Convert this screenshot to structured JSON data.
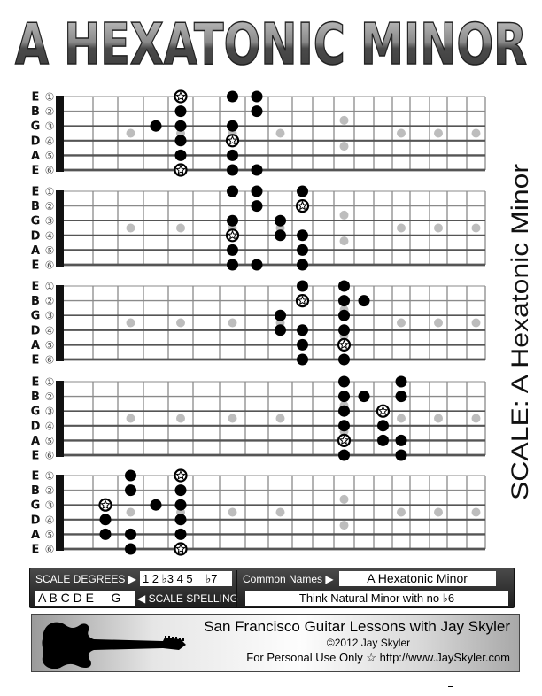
{
  "title": "A HEXATONIC MINOR",
  "side_title": "SCALE: A Hexatonic Minor",
  "strings": [
    {
      "name": "E",
      "number": "①"
    },
    {
      "name": "B",
      "number": "②"
    },
    {
      "name": "G",
      "number": "③"
    },
    {
      "name": "D",
      "number": "④"
    },
    {
      "name": "A",
      "number": "⑤"
    },
    {
      "name": "E",
      "number": "⑥"
    }
  ],
  "fretboard": {
    "fret_count": 19,
    "inlay_frets_single": [
      3,
      5,
      7,
      9,
      15,
      17,
      19
    ],
    "inlay_frets_double": [
      12
    ],
    "colors": {
      "note": "#000000",
      "root_fill": "#ffffff",
      "inlay": "#bdbdbd",
      "nut": "#111111",
      "string": "#555555",
      "fret": "#8a8a8a"
    }
  },
  "positions": [
    {
      "name": "position-1",
      "notes": [
        {
          "string": 1,
          "fret": 5,
          "root": true
        },
        {
          "string": 1,
          "fret": 7
        },
        {
          "string": 1,
          "fret": 8
        },
        {
          "string": 2,
          "fret": 5
        },
        {
          "string": 2,
          "fret": 8
        },
        {
          "string": 3,
          "fret": 4
        },
        {
          "string": 3,
          "fret": 5
        },
        {
          "string": 3,
          "fret": 7
        },
        {
          "string": 4,
          "fret": 5
        },
        {
          "string": 4,
          "fret": 7,
          "root": true
        },
        {
          "string": 5,
          "fret": 5
        },
        {
          "string": 5,
          "fret": 7
        },
        {
          "string": 6,
          "fret": 5,
          "root": true
        },
        {
          "string": 6,
          "fret": 7
        },
        {
          "string": 6,
          "fret": 8
        }
      ]
    },
    {
      "name": "position-2",
      "notes": [
        {
          "string": 1,
          "fret": 7
        },
        {
          "string": 1,
          "fret": 8
        },
        {
          "string": 1,
          "fret": 10
        },
        {
          "string": 2,
          "fret": 8
        },
        {
          "string": 2,
          "fret": 10,
          "root": true
        },
        {
          "string": 3,
          "fret": 7
        },
        {
          "string": 3,
          "fret": 9
        },
        {
          "string": 4,
          "fret": 7,
          "root": true
        },
        {
          "string": 4,
          "fret": 9
        },
        {
          "string": 4,
          "fret": 10
        },
        {
          "string": 5,
          "fret": 7
        },
        {
          "string": 5,
          "fret": 10
        },
        {
          "string": 6,
          "fret": 7
        },
        {
          "string": 6,
          "fret": 8
        },
        {
          "string": 6,
          "fret": 10
        }
      ]
    },
    {
      "name": "position-3",
      "notes": [
        {
          "string": 1,
          "fret": 10
        },
        {
          "string": 1,
          "fret": 12
        },
        {
          "string": 2,
          "fret": 10,
          "root": true
        },
        {
          "string": 2,
          "fret": 12
        },
        {
          "string": 2,
          "fret": 13
        },
        {
          "string": 3,
          "fret": 9
        },
        {
          "string": 3,
          "fret": 12
        },
        {
          "string": 4,
          "fret": 9
        },
        {
          "string": 4,
          "fret": 10
        },
        {
          "string": 4,
          "fret": 12
        },
        {
          "string": 5,
          "fret": 10
        },
        {
          "string": 5,
          "fret": 12,
          "root": true
        },
        {
          "string": 6,
          "fret": 10
        },
        {
          "string": 6,
          "fret": 12
        }
      ]
    },
    {
      "name": "position-4",
      "notes": [
        {
          "string": 1,
          "fret": 12
        },
        {
          "string": 1,
          "fret": 15
        },
        {
          "string": 2,
          "fret": 12
        },
        {
          "string": 2,
          "fret": 13
        },
        {
          "string": 2,
          "fret": 15
        },
        {
          "string": 3,
          "fret": 12
        },
        {
          "string": 3,
          "fret": 14,
          "root": true
        },
        {
          "string": 4,
          "fret": 12
        },
        {
          "string": 4,
          "fret": 14
        },
        {
          "string": 5,
          "fret": 12,
          "root": true
        },
        {
          "string": 5,
          "fret": 14
        },
        {
          "string": 5,
          "fret": 15
        },
        {
          "string": 6,
          "fret": 12
        },
        {
          "string": 6,
          "fret": 15
        }
      ]
    },
    {
      "name": "position-5",
      "notes": [
        {
          "string": 1,
          "fret": 3
        },
        {
          "string": 1,
          "fret": 5,
          "root": true
        },
        {
          "string": 2,
          "fret": 3
        },
        {
          "string": 2,
          "fret": 5
        },
        {
          "string": 3,
          "fret": 2,
          "root": true
        },
        {
          "string": 3,
          "fret": 4
        },
        {
          "string": 3,
          "fret": 5
        },
        {
          "string": 4,
          "fret": 2
        },
        {
          "string": 4,
          "fret": 5
        },
        {
          "string": 5,
          "fret": 2
        },
        {
          "string": 5,
          "fret": 3
        },
        {
          "string": 5,
          "fret": 5
        },
        {
          "string": 6,
          "fret": 3
        },
        {
          "string": 6,
          "fret": 5,
          "root": true
        }
      ]
    }
  ],
  "info": {
    "scale_degrees_label": "SCALE DEGREES ▶",
    "scale_degrees_value": "1 2 ♭3 4 5    ♭7",
    "scale_spelling_value": "A B C D E     G",
    "scale_spelling_label": "◀ SCALE SPELLING",
    "common_names_label": "Common Names ▶",
    "common_names_value": "A Hexatonic Minor",
    "note": "Think Natural Minor with no ♭6"
  },
  "footer": {
    "line1": "San Francisco Guitar Lessons with Jay Skyler",
    "line2": "©2012 Jay Skyler",
    "line3": "For Personal Use Only  ☆  http://www.JaySkyler.com"
  }
}
